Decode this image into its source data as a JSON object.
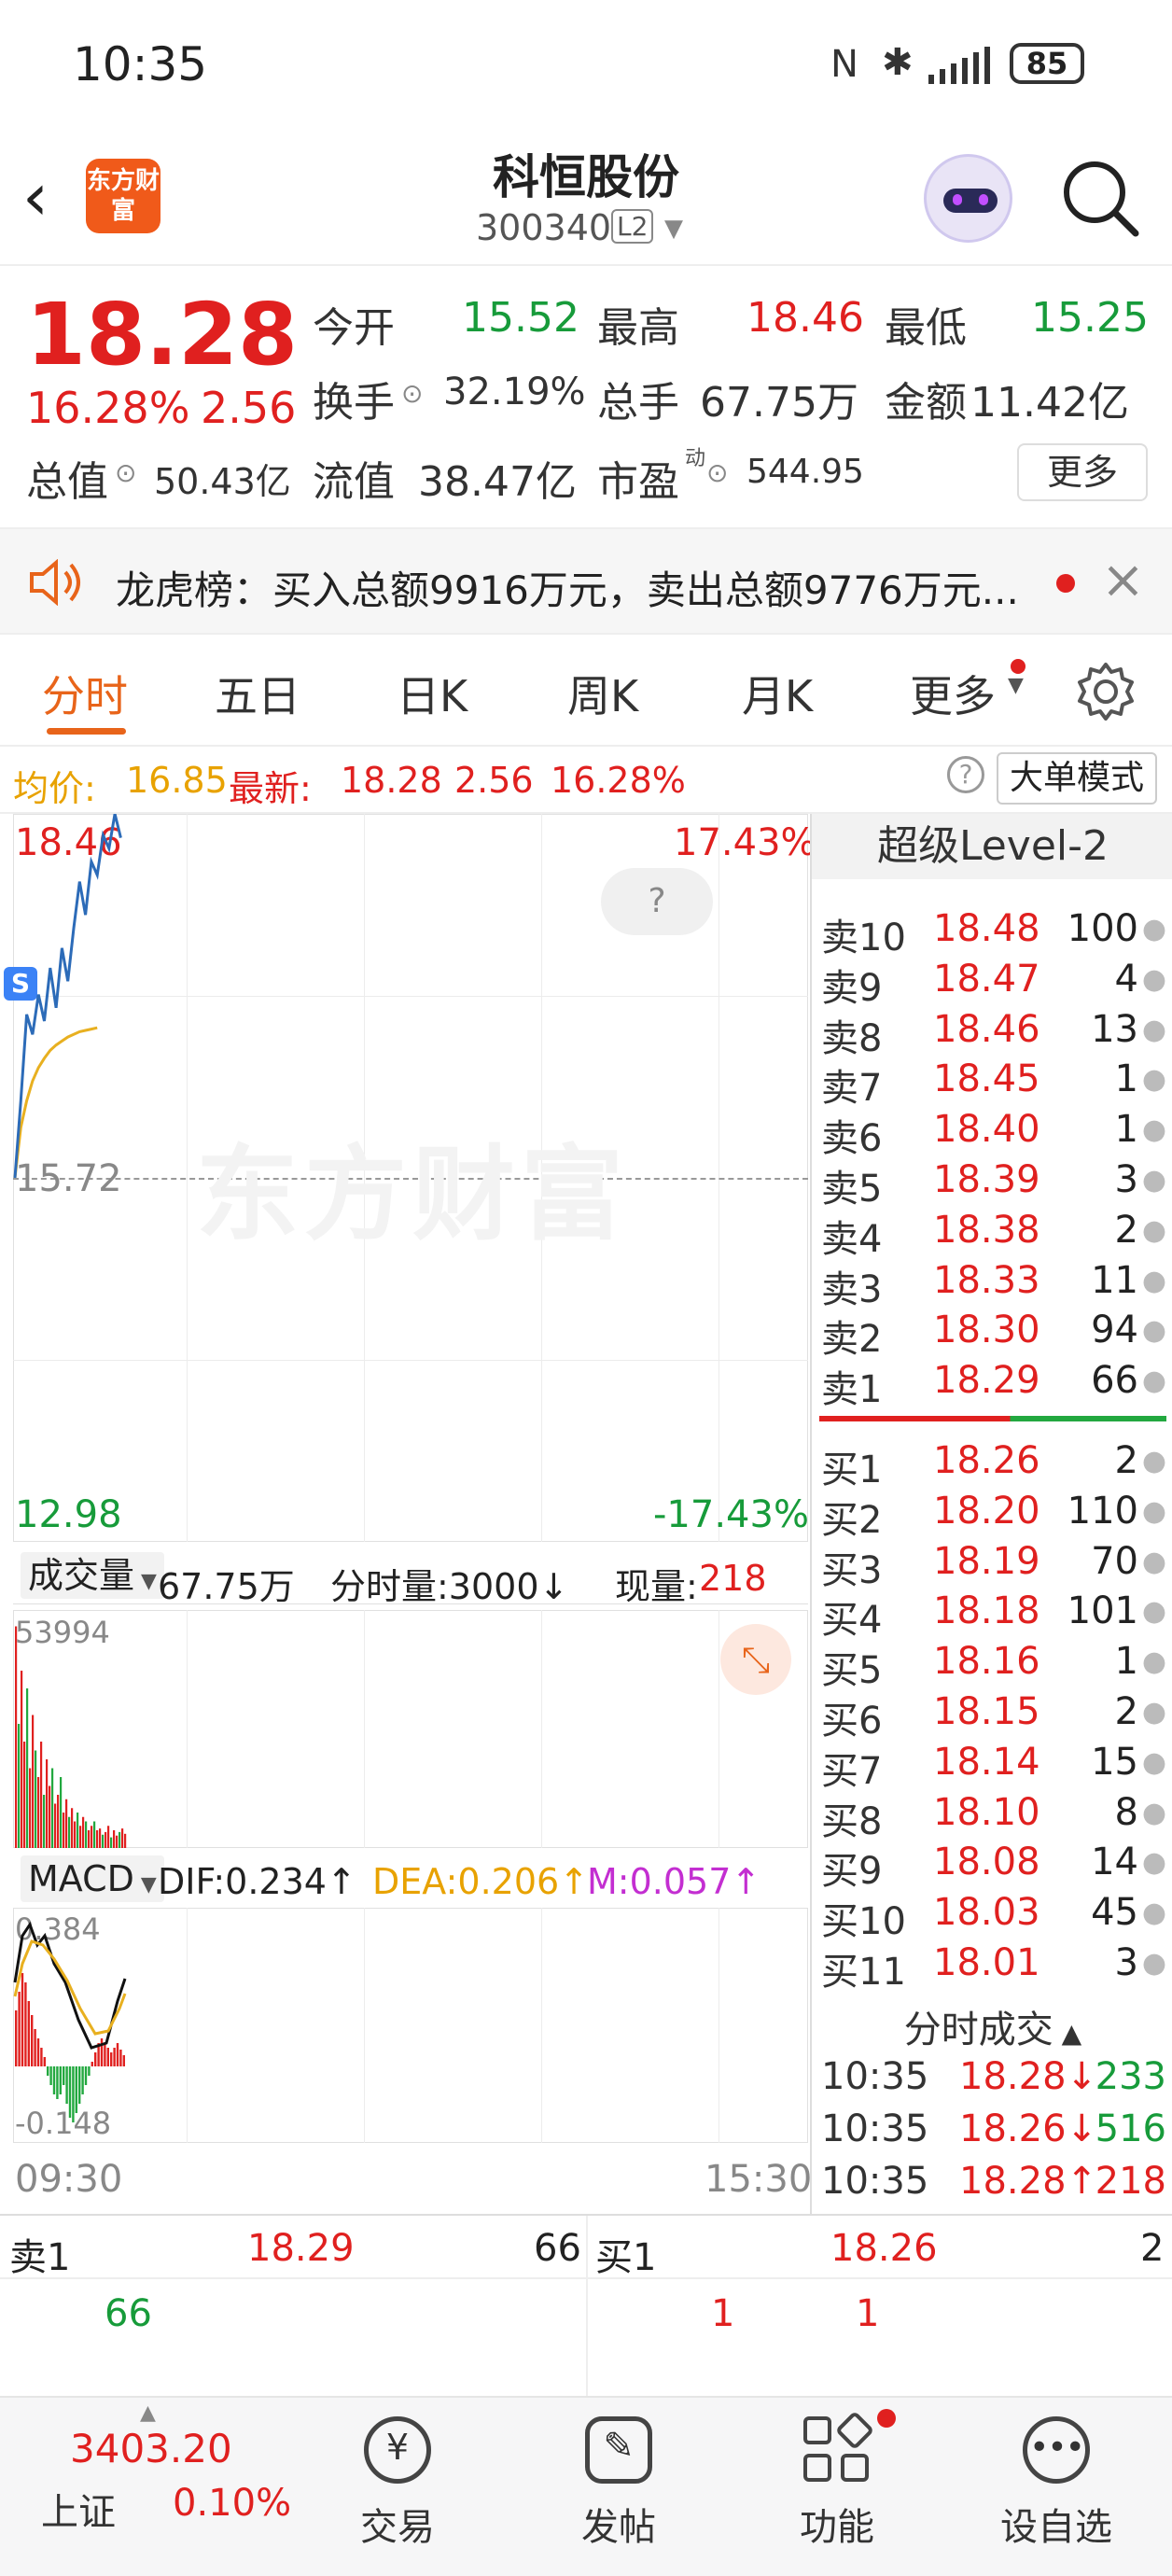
{
  "status": {
    "time": "10:35",
    "battery": "85"
  },
  "header": {
    "stock_name": "科恒股份",
    "stock_code": "300340",
    "level_badge": "L2",
    "logo_text": "东方财富"
  },
  "quote": {
    "price": "18.28",
    "change_pct": "16.28%",
    "change": "2.56",
    "open_label": "今开",
    "open": "15.52",
    "high_label": "最高",
    "high": "18.46",
    "low_label": "最低",
    "low": "15.25",
    "turnover_label": "换手",
    "turnover": "32.19%",
    "volume_label": "总手",
    "volume": "67.75万",
    "amount_label": "金额",
    "amount": "11.42亿",
    "mktcap_label": "总值",
    "mktcap": "50.43亿",
    "float_label": "流值",
    "float": "38.47亿",
    "pe_label": "市盈",
    "pe_sup": "动",
    "pe": "544.95",
    "more_button": "更多"
  },
  "notice": {
    "text": "龙虎榜：买入总额9916万元，卖出总额9776万元..."
  },
  "tabs": [
    "分时",
    "五日",
    "日K",
    "周K",
    "月K",
    "更多"
  ],
  "avgbar": {
    "avg_label": "均价:",
    "avg": "16.85",
    "last_label": "最新:",
    "last": "18.28",
    "chg": "2.56",
    "pct": "16.28%",
    "mode_button": "大单模式"
  },
  "chart": {
    "top_price": "18.46",
    "top_pct": "17.43%",
    "mid_price": "15.72",
    "bottom_price": "12.98",
    "bottom_pct": "-17.43%",
    "watermark": "东方财富",
    "help": "?",
    "s_marker": "S",
    "vol_label": "成交量",
    "vol_total": "67.75万",
    "tick_vol_label": "分时量:3000↓",
    "cur_vol_label": "现量:",
    "cur_vol": "218",
    "vol_max": "53994",
    "macd_label": "MACD",
    "dif": "DIF:0.234↑",
    "dea": "DEA:0.206↑",
    "m": "M:0.057↑",
    "macd_top": "0.384",
    "macd_bottom": "-0.148",
    "time_start": "09:30",
    "time_end": "15:30"
  },
  "orderbook": {
    "title": "超级Level-2",
    "asks": [
      {
        "label": "卖10",
        "price": "18.48",
        "qty": "100"
      },
      {
        "label": "卖9",
        "price": "18.47",
        "qty": "4"
      },
      {
        "label": "卖8",
        "price": "18.46",
        "qty": "13"
      },
      {
        "label": "卖7",
        "price": "18.45",
        "qty": "1"
      },
      {
        "label": "卖6",
        "price": "18.40",
        "qty": "1"
      },
      {
        "label": "卖5",
        "price": "18.39",
        "qty": "3"
      },
      {
        "label": "卖4",
        "price": "18.38",
        "qty": "2"
      },
      {
        "label": "卖3",
        "price": "18.33",
        "qty": "11"
      },
      {
        "label": "卖2",
        "price": "18.30",
        "qty": "94"
      },
      {
        "label": "卖1",
        "price": "18.29",
        "qty": "66"
      }
    ],
    "bids": [
      {
        "label": "买1",
        "price": "18.26",
        "qty": "2"
      },
      {
        "label": "买2",
        "price": "18.20",
        "qty": "110"
      },
      {
        "label": "买3",
        "price": "18.19",
        "qty": "70"
      },
      {
        "label": "买4",
        "price": "18.18",
        "qty": "101"
      },
      {
        "label": "买5",
        "price": "18.16",
        "qty": "1"
      },
      {
        "label": "买6",
        "price": "18.15",
        "qty": "2"
      },
      {
        "label": "买7",
        "price": "18.14",
        "qty": "15"
      },
      {
        "label": "买8",
        "price": "18.10",
        "qty": "8"
      },
      {
        "label": "买9",
        "price": "18.08",
        "qty": "14"
      },
      {
        "label": "买10",
        "price": "18.03",
        "qty": "45"
      },
      {
        "label": "买11",
        "price": "18.01",
        "qty": "3"
      }
    ],
    "trades_title": "分时成交",
    "trades": [
      {
        "time": "10:35",
        "price": "18.28↓",
        "qty": "233"
      },
      {
        "time": "10:35",
        "price": "18.26↓",
        "qty": "516"
      },
      {
        "time": "10:35",
        "price": "18.28↑",
        "qty": "218"
      }
    ]
  },
  "bottom_quote": {
    "ask_label": "卖1",
    "ask_price": "18.29",
    "ask_qty": "66",
    "ask_detail": "66",
    "bid_label": "买1",
    "bid_price": "18.26",
    "bid_qty": "2",
    "bid_detail_1": "1",
    "bid_detail_2": "1"
  },
  "nav": {
    "index_value": "3403.20",
    "index_name": "上证",
    "index_pct": "0.10%",
    "items": [
      "交易",
      "发帖",
      "功能",
      "设自选"
    ]
  },
  "chart_data": [
    {
      "type": "line",
      "series": [
        {
          "values": [
            15.72,
            16.3,
            16.95,
            16.8,
            17.1,
            16.9,
            17.3,
            17.0,
            17.45,
            17.2,
            17.6,
            17.95,
            17.7,
            18.1,
            18.0,
            18.3,
            18.2,
            18.46,
            18.28
          ]
        },
        {
          "values": [
            15.72,
            16.1,
            16.3,
            16.45,
            16.55,
            16.62,
            16.68,
            16.72,
            16.75,
            16.78,
            16.8,
            16.82,
            16.83,
            16.84,
            16.85
          ]
        }
      ],
      "ylim": [
        12.98,
        18.46
      ]
    }
  ]
}
